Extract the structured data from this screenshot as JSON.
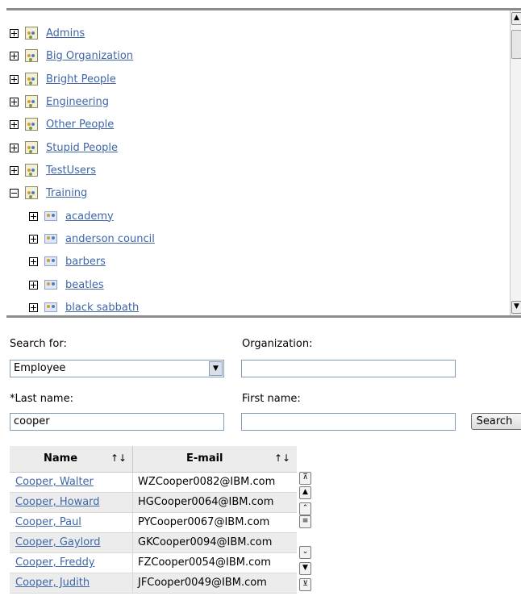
{
  "tree": {
    "organizations": [
      {
        "label": "Admins",
        "expanded": false
      },
      {
        "label": "Big Organization",
        "expanded": false
      },
      {
        "label": "Bright People",
        "expanded": false
      },
      {
        "label": "Engineering",
        "expanded": false
      },
      {
        "label": "Other People",
        "expanded": false
      },
      {
        "label": "Stupid People",
        "expanded": false
      },
      {
        "label": "TestUsers",
        "expanded": false
      },
      {
        "label": "Training",
        "expanded": true
      }
    ],
    "training_groups": [
      "academy",
      "anderson council",
      "barbers",
      "beatles",
      "black sabbath"
    ]
  },
  "search": {
    "search_for_label": "Search for:",
    "search_for_value": "Employee",
    "organization_label": "Organization:",
    "organization_value": "",
    "last_name_label": "*Last name:",
    "last_name_value": "cooper",
    "first_name_label": "First name:",
    "first_name_value": "",
    "search_button": "Search"
  },
  "results": {
    "columns": [
      "Name",
      "E-mail"
    ],
    "rows": [
      {
        "name": "Cooper, Walter",
        "email": "WZCooper0082@IBM.com"
      },
      {
        "name": "Cooper, Howard",
        "email": "HGCooper0064@IBM.com"
      },
      {
        "name": "Cooper, Paul",
        "email": "PYCooper0067@IBM.com"
      },
      {
        "name": "Cooper, Gaylord",
        "email": "GKCooper0094@IBM.com"
      },
      {
        "name": "Cooper, Freddy",
        "email": "FZCooper0054@IBM.com"
      },
      {
        "name": "Cooper, Judith",
        "email": "JFCooper0049@IBM.com"
      }
    ]
  },
  "colors": {
    "link": "#3f66a8",
    "row_alt": "#ececec",
    "header_bg": "#ececec"
  }
}
